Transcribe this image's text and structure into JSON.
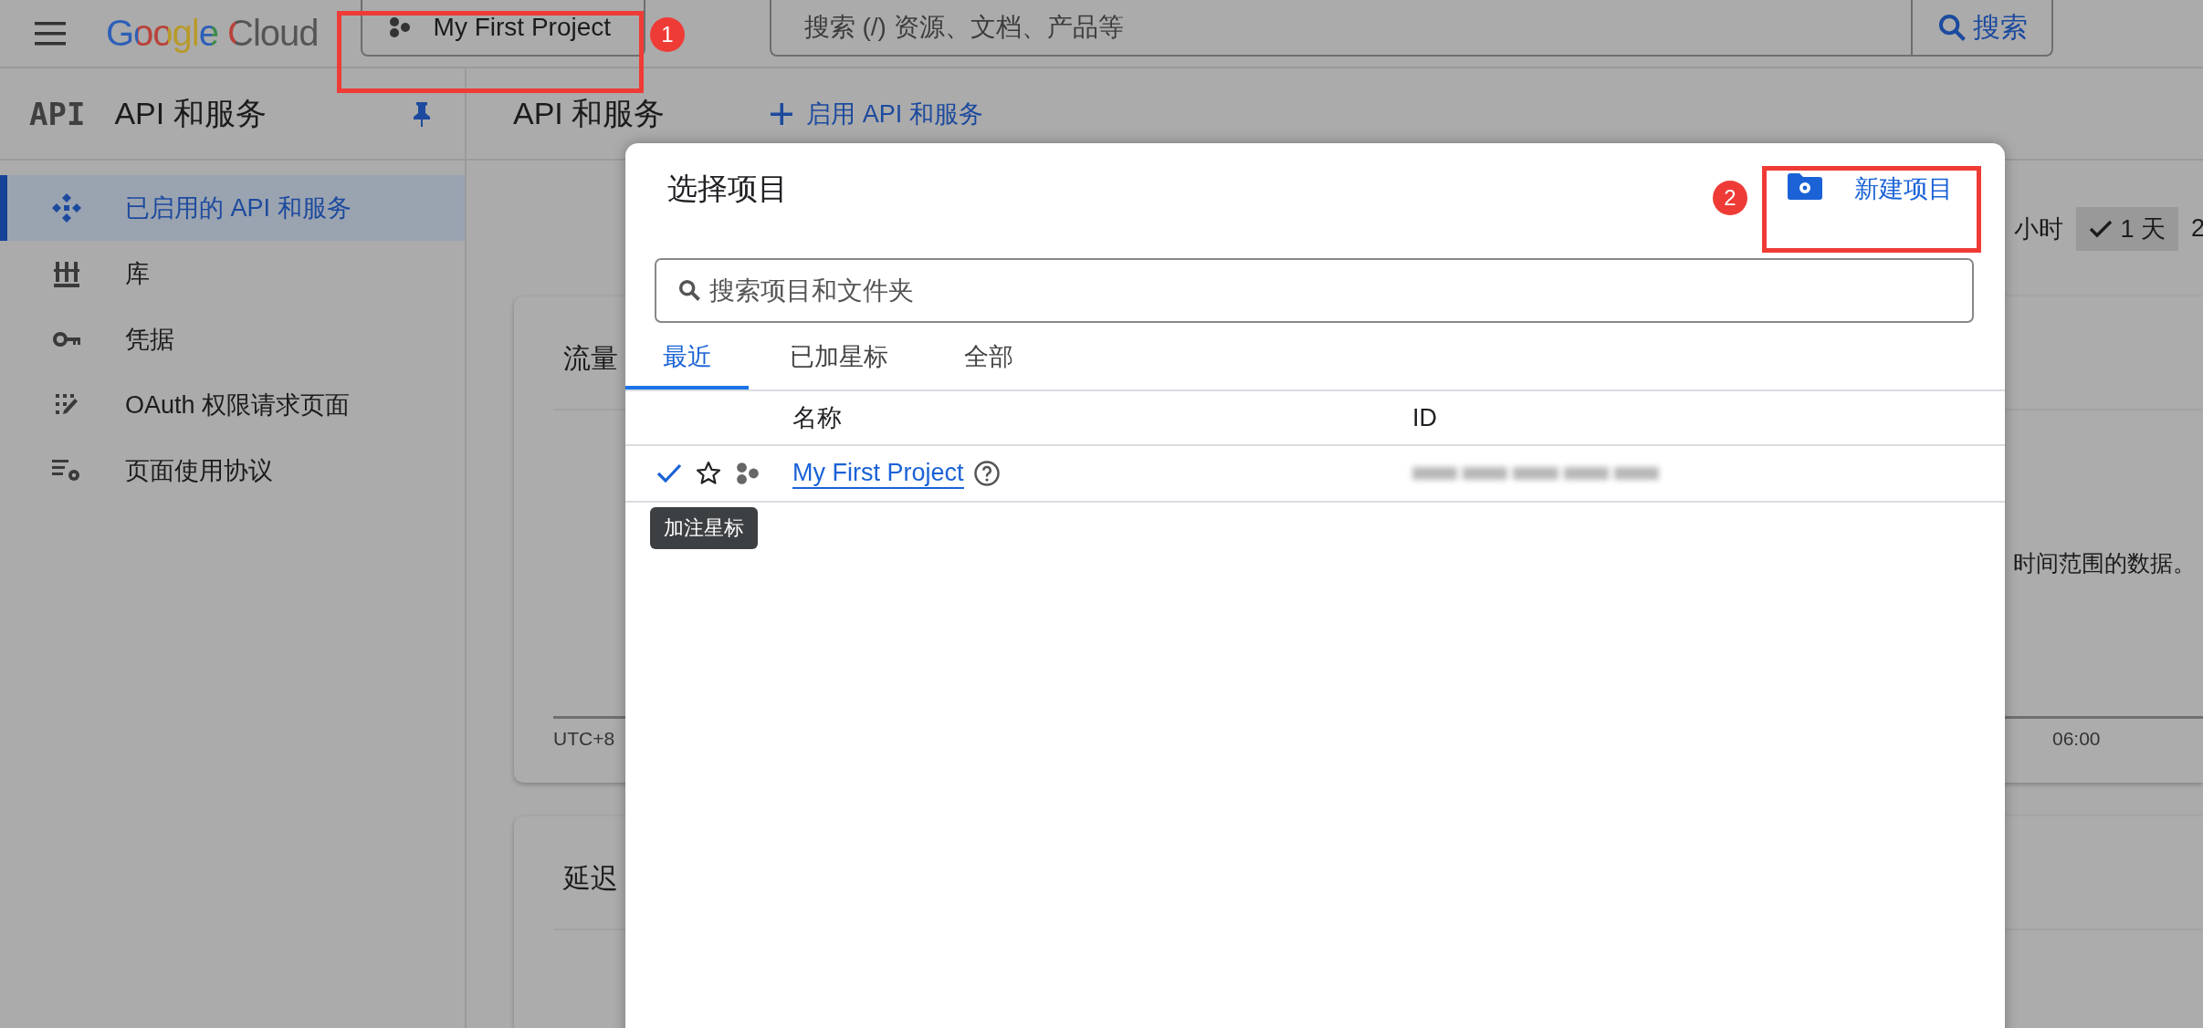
{
  "topbar": {
    "logo": "Google Cloud",
    "project": "My First Project",
    "search": {
      "placeholder": "搜索 (/) 资源、文档、产品等",
      "button": "搜索"
    }
  },
  "sidebar": {
    "logo": "API",
    "title": "API 和服务",
    "items": [
      {
        "label": "已启用的 API 和服务",
        "selected": true
      },
      {
        "label": "库",
        "selected": false
      },
      {
        "label": "凭据",
        "selected": false
      },
      {
        "label": "OAuth 权限请求页面",
        "selected": false
      },
      {
        "label": "页面使用协议",
        "selected": false
      }
    ]
  },
  "header": {
    "title": "API 和服务",
    "action": "启用 API 和服务"
  },
  "time_ranges": [
    {
      "label": "小时",
      "selected": false
    },
    {
      "label": "1 天",
      "selected": true
    },
    {
      "label": "2",
      "selected": false
    }
  ],
  "cards": [
    {
      "title": "流量",
      "message": "时间范围的数据。",
      "timezone": "UTC+8",
      "tick": "06:00"
    },
    {
      "title": "延迟"
    }
  ],
  "dialog": {
    "title": "选择项目",
    "new_project": "新建项目",
    "search": {
      "placeholder": "搜索项目和文件夹"
    },
    "tabs": [
      {
        "label": "最近",
        "selected": true
      },
      {
        "label": "已加星标",
        "selected": false
      },
      {
        "label": "全部",
        "selected": false
      }
    ],
    "columns": [
      "名称",
      "ID"
    ],
    "rows": [
      {
        "name": "My First Project",
        "current": true,
        "starred": false
      }
    ],
    "tooltip": "加注星标"
  },
  "annotations": [
    {
      "number": "1"
    },
    {
      "number": "2"
    }
  ]
}
